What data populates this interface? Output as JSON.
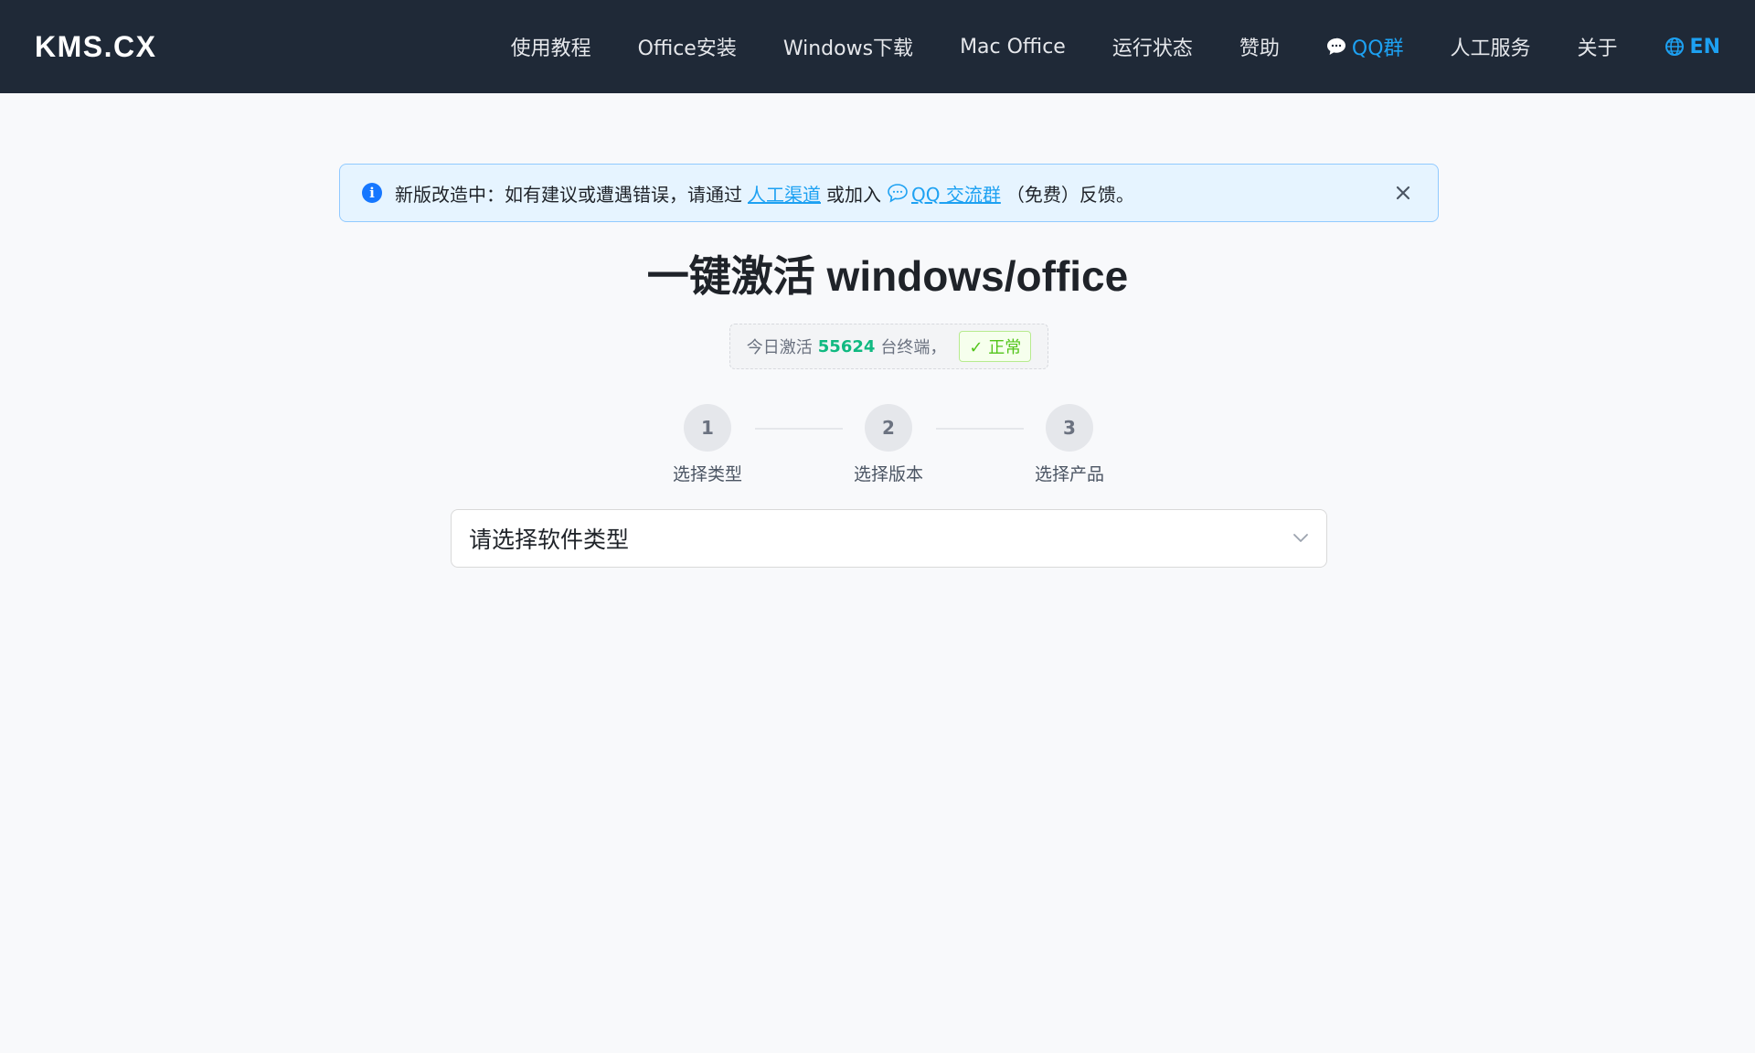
{
  "header": {
    "logo": "KMS.CX",
    "nav": {
      "tutorial": "使用教程",
      "office_install": "Office安装",
      "windows_download": "Windows下载",
      "mac_office": "Mac Office",
      "status": "运行状态",
      "sponsor": "赞助",
      "qq_group": "QQ群",
      "manual_service": "人工服务",
      "about": "关于",
      "language": "EN"
    },
    "accent_color": "#1da1f2",
    "background_color": "#1f2937"
  },
  "notice": {
    "prefix": "新版改造中：如有建议或遭遇错误，请通过",
    "manual_link": "人工渠道",
    "middle": "或加入",
    "qq_link": "QQ 交流群",
    "suffix": "（免费）反馈。"
  },
  "title": "一键激活 windows/office",
  "stats": {
    "prefix": "今日激活",
    "count": "55624",
    "suffix": "台终端，",
    "status": "✓ 正常"
  },
  "steps": [
    {
      "number": "1",
      "label": "选择类型"
    },
    {
      "number": "2",
      "label": "选择版本"
    },
    {
      "number": "3",
      "label": "选择产品"
    }
  ],
  "select": {
    "placeholder": "请选择软件类型"
  }
}
